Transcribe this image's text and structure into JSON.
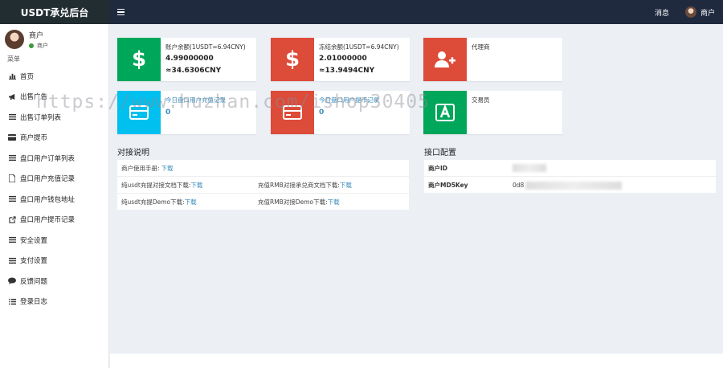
{
  "app": {
    "title": "USDT承兑后台"
  },
  "header": {
    "messages_label": "消息",
    "user_label": "商户"
  },
  "sidebar": {
    "user": {
      "name": "商户",
      "status": "商户"
    },
    "menu_header": "菜单",
    "items": [
      {
        "label": "首页",
        "icon": "bar-chart-icon"
      },
      {
        "label": "出售广告",
        "icon": "bullhorn-icon"
      },
      {
        "label": "出售订单列表",
        "icon": "list-icon"
      },
      {
        "label": "商户提币",
        "icon": "credit-card-icon"
      },
      {
        "label": "盘口用户订单列表",
        "icon": "list-icon"
      },
      {
        "label": "盘口用户充值记录",
        "icon": "file-icon"
      },
      {
        "label": "盘口用户钱包地址",
        "icon": "list-icon"
      },
      {
        "label": "盘口用户提币记录",
        "icon": "external-link-icon"
      },
      {
        "label": "安全设置",
        "icon": "list-icon"
      },
      {
        "label": "支付设置",
        "icon": "list-icon"
      },
      {
        "label": "反馈问题",
        "icon": "comment-icon"
      },
      {
        "label": "登录日志",
        "icon": "list-ol-icon"
      }
    ]
  },
  "cards": {
    "balance": {
      "label": "账户余额(1USDT=6.94CNY)",
      "usdt": "4.99000000",
      "cny": "≈34.6306CNY"
    },
    "frozen": {
      "label": "冻结余额(1USDT=6.94CNY)",
      "usdt": "2.01000000",
      "cny": "≈13.9494CNY"
    },
    "agent": {
      "label": "代理商"
    },
    "trader": {
      "label": "交易员"
    },
    "card4": {
      "label": "今日盘口用户充值记录",
      "value": "0"
    },
    "card5": {
      "label": "今日盘口用户提币记录",
      "value": "0"
    }
  },
  "docs": {
    "title": "对接说明",
    "manual_label": "商户使用手册:",
    "download": "下载",
    "rows": [
      {
        "left": "纯usdt充提对接文档下载:",
        "right": "充值RMB对接承兑商文档下载:"
      },
      {
        "left": "纯usdt充提Demo下载:",
        "right": "充值RMB对接Demo下载:"
      }
    ]
  },
  "config": {
    "title": "接口配置",
    "merchant_id_label": "商户ID",
    "md5key_label": "商户MD5Key",
    "md5key_prefix": "0d8"
  },
  "watermark": "https://www.huzhan.com/ishop30405",
  "colors": {
    "green": "#00a65a",
    "red": "#dd4b39",
    "aqua": "#00c0ef",
    "topbar": "#1f2a3f",
    "link": "#3c8dbc"
  }
}
